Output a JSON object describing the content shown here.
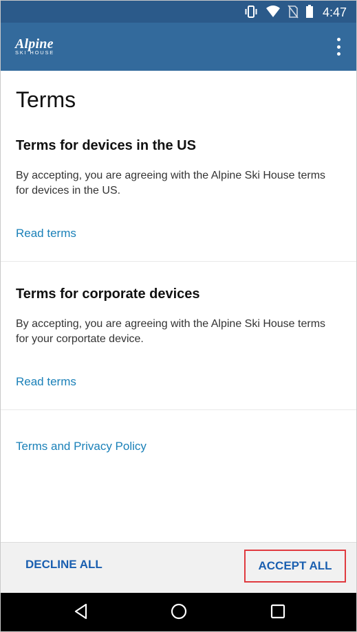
{
  "status": {
    "time": "4:47"
  },
  "app": {
    "logo_main": "Alpine",
    "logo_sub": "SKI HOUSE"
  },
  "page": {
    "title": "Terms"
  },
  "sections": [
    {
      "title": "Terms for devices in the US",
      "text": "By accepting, you are agreeing with the Alpine Ski House terms for devices in the US.",
      "link": "Read terms"
    },
    {
      "title": "Terms for corporate devices",
      "text": "By accepting, you are agreeing with the Alpine Ski House terms for your corportate device.",
      "link": "Read terms"
    }
  ],
  "privacy_link": "Terms and Privacy Policy",
  "footer": {
    "decline": "DECLINE ALL",
    "accept": "ACCEPT ALL"
  },
  "colors": {
    "appbar": "#336a9c",
    "statusbar": "#2b5a8a",
    "link": "#1a80b8",
    "button": "#1a5fb0",
    "highlight": "#e0393e"
  },
  "icons": {
    "status": [
      "vibrate-icon",
      "wifi-icon",
      "no-sim-icon",
      "battery-icon"
    ],
    "nav": [
      "back-icon",
      "home-icon",
      "recent-apps-icon"
    ],
    "menu": "overflow-menu-icon"
  }
}
